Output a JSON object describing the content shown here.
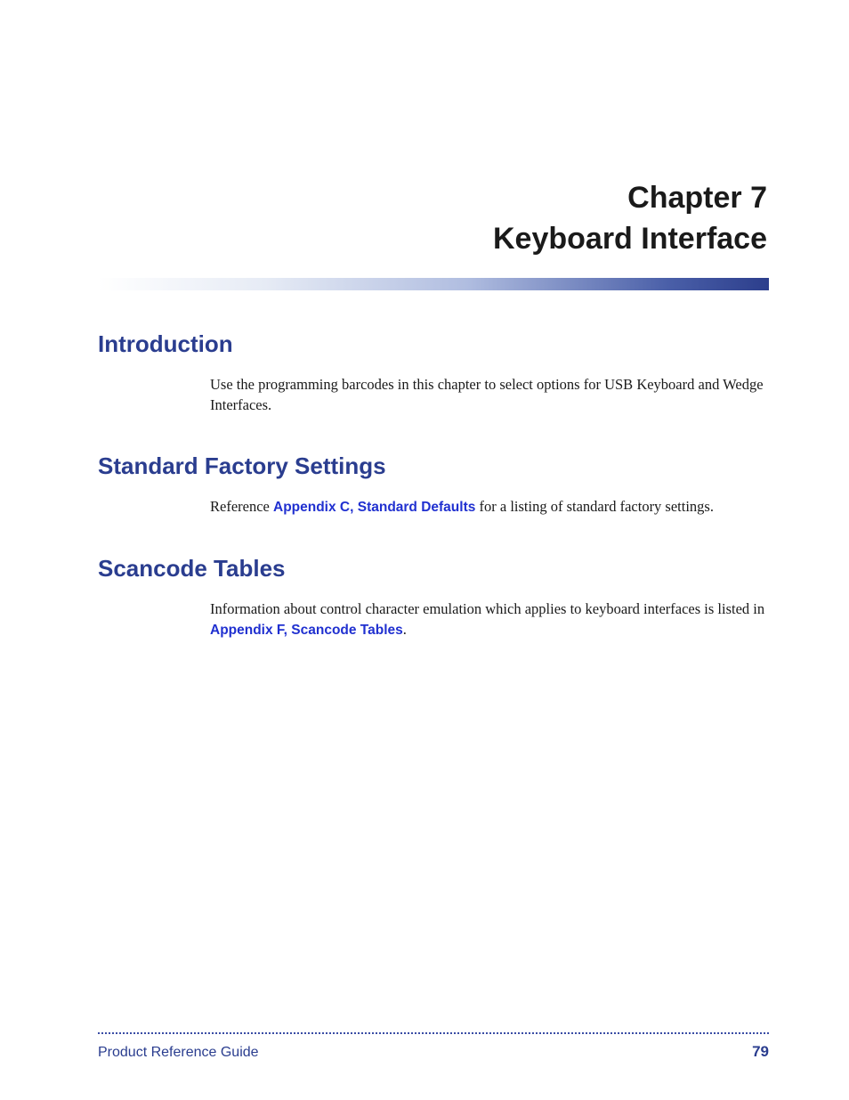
{
  "chapter": {
    "number_label": "Chapter 7",
    "title": "Keyboard Interface"
  },
  "sections": {
    "introduction": {
      "heading": "Introduction",
      "body": "Use the programming barcodes in this chapter to select options for USB Keyboard and Wedge Interfaces."
    },
    "factory_settings": {
      "heading": "Standard Factory Settings",
      "body_prefix": "Reference ",
      "link": "Appendix C, Standard Defaults",
      "body_suffix": " for a listing of standard factory settings."
    },
    "scancode_tables": {
      "heading": "Scancode Tables",
      "body_prefix": "Information about control character emulation which applies to keyboard interfaces is listed in ",
      "link": "Appendix F, Scancode Tables",
      "body_suffix": "."
    }
  },
  "footer": {
    "guide_label": "Product Reference Guide",
    "page_number": "79"
  }
}
